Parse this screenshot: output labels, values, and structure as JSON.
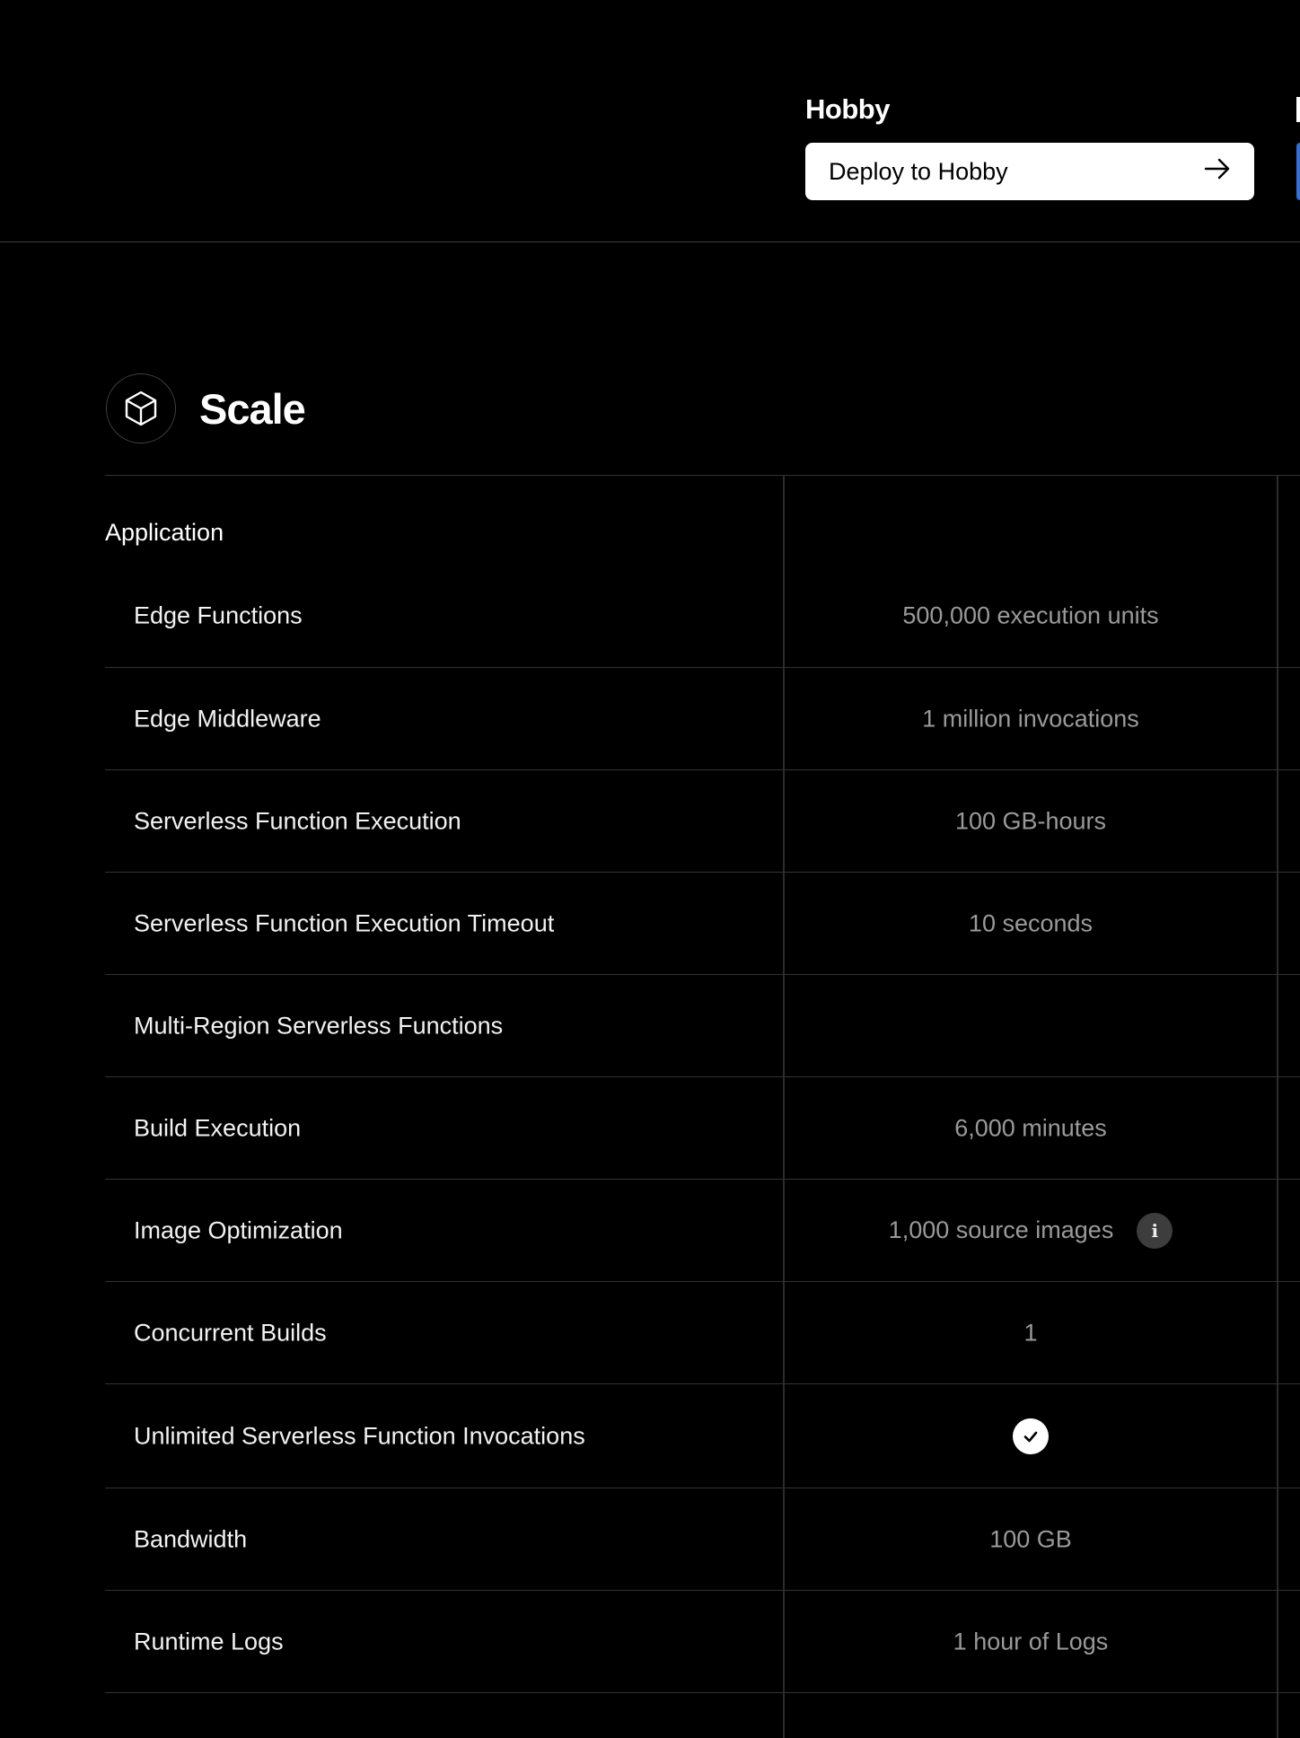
{
  "header": {
    "plan_name": "Hobby",
    "deploy_button_label": "Deploy to Hobby"
  },
  "section": {
    "title": "Scale",
    "icon": "cube-icon"
  },
  "table": {
    "group_label": "Application",
    "rows": [
      {
        "label": "Edge Functions",
        "value": "500,000 execution units"
      },
      {
        "label": "Edge Middleware",
        "value": "1 million invocations"
      },
      {
        "label": "Serverless Function Execution",
        "value": "100 GB-hours"
      },
      {
        "label": "Serverless Function Execution Timeout",
        "value": "10 seconds"
      },
      {
        "label": "Multi-Region Serverless Functions",
        "value": ""
      },
      {
        "label": "Build Execution",
        "value": "6,000 minutes"
      },
      {
        "label": "Image Optimization",
        "value": "1,000 source images",
        "info": true
      },
      {
        "label": "Concurrent Builds",
        "value": "1"
      },
      {
        "label": "Unlimited Serverless Function Invocations",
        "value": "",
        "check": true
      },
      {
        "label": "Bandwidth",
        "value": "100 GB"
      },
      {
        "label": "Runtime Logs",
        "value": "1 hour of Logs"
      },
      {
        "label": "",
        "value": ""
      }
    ]
  },
  "colors": {
    "background": "#000000",
    "accent": "#2f6fde",
    "muted_text": "#9a9a9a"
  }
}
